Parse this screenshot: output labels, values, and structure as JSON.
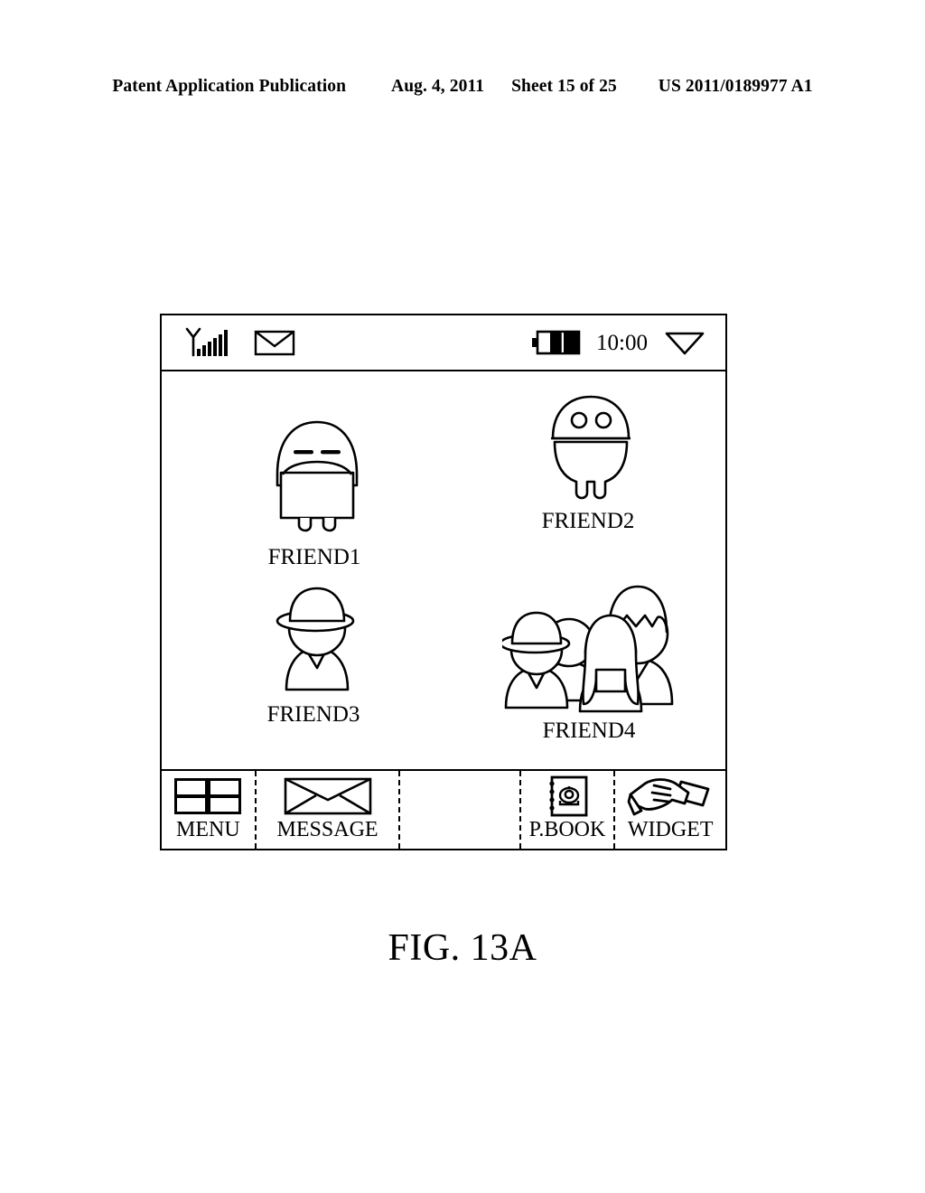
{
  "patent_header": {
    "publication": "Patent Application Publication",
    "date": "Aug. 4, 2011",
    "sheet": "Sheet 15 of 25",
    "number": "US 2011/0189977 A1"
  },
  "figure": {
    "caption": "FIG. 13A"
  },
  "phone": {
    "status_bar": {
      "signal_icon": "signal-antenna-bars-icon",
      "message_icon": "envelope-icon",
      "battery_icon": "battery-icon",
      "time": "10:00",
      "dropdown_icon": "triangle-down-icon"
    },
    "friends": [
      {
        "id": "friend1",
        "label": "FRIEND1",
        "avatar": "dome-character-slit-eyes-avatar"
      },
      {
        "id": "friend2",
        "label": "FRIEND2",
        "avatar": "dome-character-round-eyes-avatar"
      },
      {
        "id": "friend3",
        "label": "FRIEND3",
        "avatar": "person-with-hat-avatar"
      },
      {
        "id": "friend4",
        "label": "FRIEND4",
        "avatar": "group-of-people-avatar"
      }
    ],
    "toolbar": [
      {
        "id": "menu",
        "label": "MENU",
        "icon": "grid-four-squares-icon"
      },
      {
        "id": "message",
        "label": "MESSAGE",
        "icon": "envelope-icon"
      },
      {
        "id": "empty",
        "label": "",
        "icon": ""
      },
      {
        "id": "pbook",
        "label": "P.BOOK",
        "icon": "phonebook-telephone-icon"
      },
      {
        "id": "widget",
        "label": "WIDGET",
        "icon": "hand-holding-card-icon"
      }
    ]
  },
  "colors": {
    "ink": "#000000",
    "paper": "#ffffff"
  }
}
